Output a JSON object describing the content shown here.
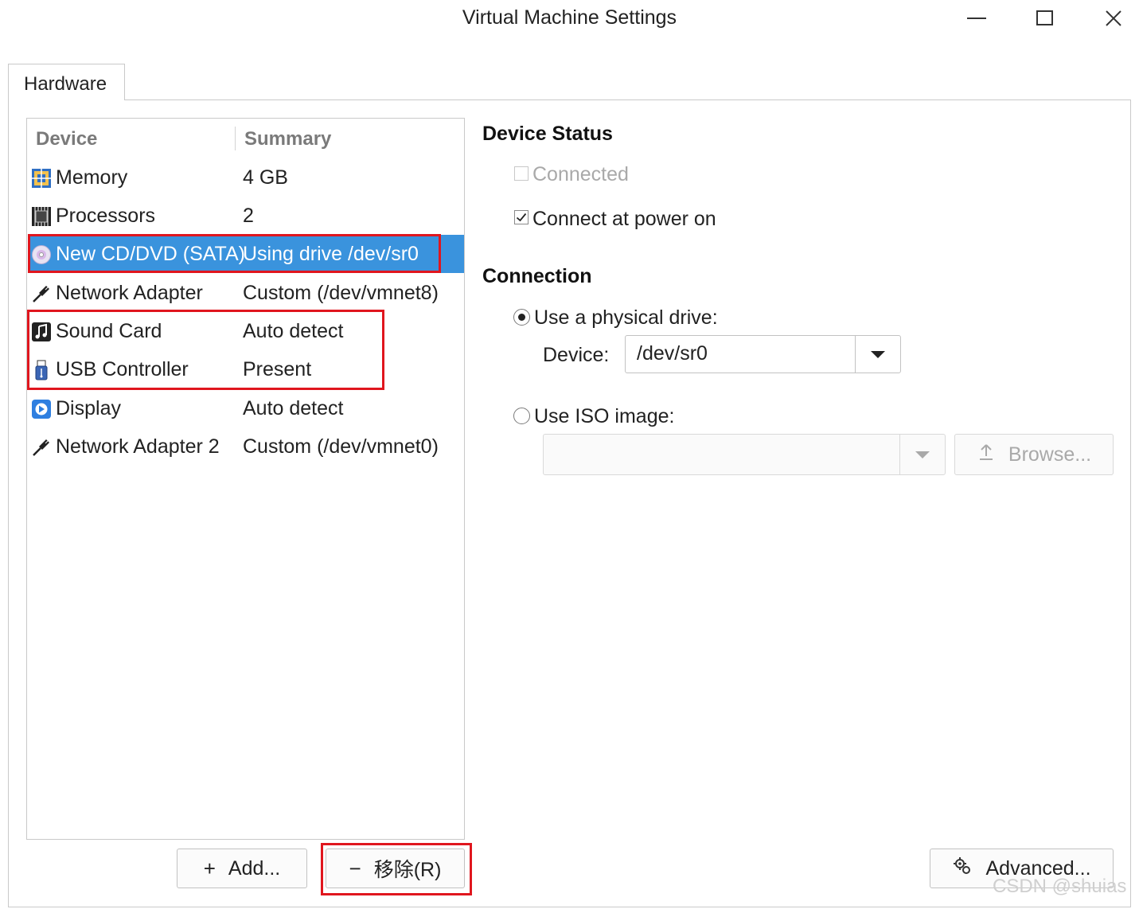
{
  "window": {
    "title": "Virtual Machine Settings",
    "minimize_icon": "minimize-icon",
    "maximize_icon": "maximize-icon",
    "close_icon": "close-icon"
  },
  "tabs": [
    {
      "label": "Hardware",
      "active": true
    }
  ],
  "device_list": {
    "headers": {
      "device": "Device",
      "summary": "Summary"
    },
    "rows": [
      {
        "device": "Memory",
        "summary": "4 GB",
        "icon": "memory-icon",
        "selected": false
      },
      {
        "device": "Processors",
        "summary": "2",
        "icon": "processor-icon",
        "selected": false
      },
      {
        "device": "New CD/DVD (SATA)",
        "summary": "Using drive /dev/sr0",
        "icon": "cd-dvd-icon",
        "selected": true
      },
      {
        "device": "Network Adapter",
        "summary": "Custom (/dev/vmnet8)",
        "icon": "network-adapter-icon",
        "selected": false
      },
      {
        "device": "Sound Card",
        "summary": "Auto detect",
        "icon": "sound-card-icon",
        "selected": false
      },
      {
        "device": "USB Controller",
        "summary": "Present",
        "icon": "usb-icon",
        "selected": false
      },
      {
        "device": "Display",
        "summary": "Auto detect",
        "icon": "display-icon",
        "selected": false
      },
      {
        "device": "Network Adapter 2",
        "summary": "Custom (/dev/vmnet0)",
        "icon": "network-adapter-icon",
        "selected": false
      }
    ]
  },
  "buttons": {
    "add": {
      "icon_glyph": "+",
      "label": "Add..."
    },
    "remove": {
      "icon_glyph": "−",
      "label": "移除(R)"
    },
    "advanced": {
      "label": "Advanced..."
    }
  },
  "device_status": {
    "heading": "Device Status",
    "connected": {
      "label": "Connected",
      "checked": false,
      "enabled": false
    },
    "connect_at_power_on": {
      "label": "Connect at power on",
      "checked": true,
      "enabled": true
    }
  },
  "connection": {
    "heading": "Connection",
    "physical": {
      "label": "Use a physical drive:",
      "selected": true
    },
    "device_label": "Device:",
    "device_value": "/dev/sr0",
    "iso": {
      "label": "Use ISO image:",
      "selected": false
    },
    "iso_value": "",
    "browse_label": "Browse..."
  },
  "colors": {
    "selection": "#3a93dd",
    "annotation_box": "#e0161e"
  },
  "watermark": "CSDN @shuias"
}
